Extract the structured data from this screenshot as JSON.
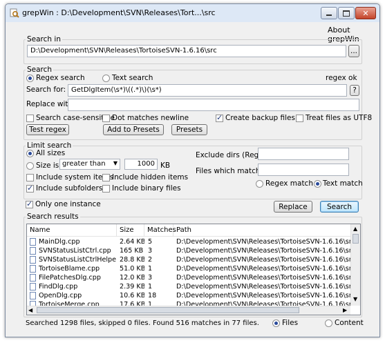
{
  "window": {
    "title": "grepWin : D:\\Development\\SVN\\Releases\\Tort...\\src",
    "menu_about": "About grepWin"
  },
  "search_in": {
    "label": "Search in",
    "path": "D:\\Development\\SVN\\Releases\\TortoiseSVN-1.6.16\\src",
    "browse": "..."
  },
  "search": {
    "label": "Search",
    "regex_label": "Regex search",
    "text_label": "Text search",
    "regex_status": "regex ok",
    "search_for_label": "Search for:",
    "search_for_value": "GetDlgItem(\\s*)\\((.*)\\)(\\s*)",
    "help": "?",
    "replace_label": "Replace with:",
    "replace_value": "",
    "case_sensitive": "Search case-sensitive",
    "dot_newline": "Dot matches newline",
    "create_backup": "Create backup files",
    "treat_utf8": "Treat files as UTF8",
    "test_regex": "Test regex",
    "add_presets": "Add to Presets",
    "presets": "Presets"
  },
  "limit": {
    "label": "Limit search",
    "all_sizes": "All sizes",
    "size_is": "Size is",
    "size_op": "greater than",
    "size_value": "1000",
    "size_unit": "KB",
    "include_system": "Include system items",
    "include_hidden": "Include hidden items",
    "include_subfolders": "Include subfolders",
    "include_binary": "Include binary files",
    "exclude_dirs_label": "Exclude dirs (Regex):",
    "exclude_dirs_value": "",
    "files_match_label": "Files which match:",
    "files_match_value": "",
    "regex_match": "Regex match",
    "text_match": "Text match"
  },
  "actions": {
    "one_instance": "Only one instance",
    "replace": "Replace",
    "search": "Search"
  },
  "results": {
    "label": "Search results",
    "columns": [
      "Name",
      "Size",
      "Matches",
      "Path"
    ],
    "rows": [
      {
        "name": "MainDlg.cpp",
        "size": "2.64 KB",
        "matches": "5",
        "path": "D:\\Development\\SVN\\Releases\\TortoiseSVN-1.6.16\\src\\crashrpt"
      },
      {
        "name": "SVNStatusListCtrl.cpp",
        "size": "165 KB",
        "matches": "3",
        "path": "D:\\Development\\SVN\\Releases\\TortoiseSVN-1.6.16\\src\\SVN"
      },
      {
        "name": "SVNStatusListCtrlHelpers.cpp",
        "size": "28.8 KB",
        "matches": "2",
        "path": "D:\\Development\\SVN\\Releases\\TortoiseSVN-1.6.16\\src\\SVN"
      },
      {
        "name": "TortoiseBlame.cpp",
        "size": "51.0 KB",
        "matches": "1",
        "path": "D:\\Development\\SVN\\Releases\\TortoiseSVN-1.6.16\\src\\TortoiseBlar"
      },
      {
        "name": "FilePatchesDlg.cpp",
        "size": "12.0 KB",
        "matches": "3",
        "path": "D:\\Development\\SVN\\Releases\\TortoiseSVN-1.6.16\\src\\TortoiseMer"
      },
      {
        "name": "FindDlg.cpp",
        "size": "2.39 KB",
        "matches": "1",
        "path": "D:\\Development\\SVN\\Releases\\TortoiseSVN-1.6.16\\src\\TortoiseMer"
      },
      {
        "name": "OpenDlg.cpp",
        "size": "10.6 KB",
        "matches": "18",
        "path": "D:\\Development\\SVN\\Releases\\TortoiseSVN-1.6.16\\src\\TortoiseMer"
      },
      {
        "name": "TortoiseMerge.cpp",
        "size": "17.6 KB",
        "matches": "1",
        "path": "D:\\Development\\SVN\\Releases\\TortoiseSVN-1.6.16\\src\\TortoiseMer"
      }
    ]
  },
  "status": {
    "text": "Searched 1298 files, skipped 0 files. Found 516 matches in 77 files.",
    "files": "Files",
    "content": "Content"
  }
}
